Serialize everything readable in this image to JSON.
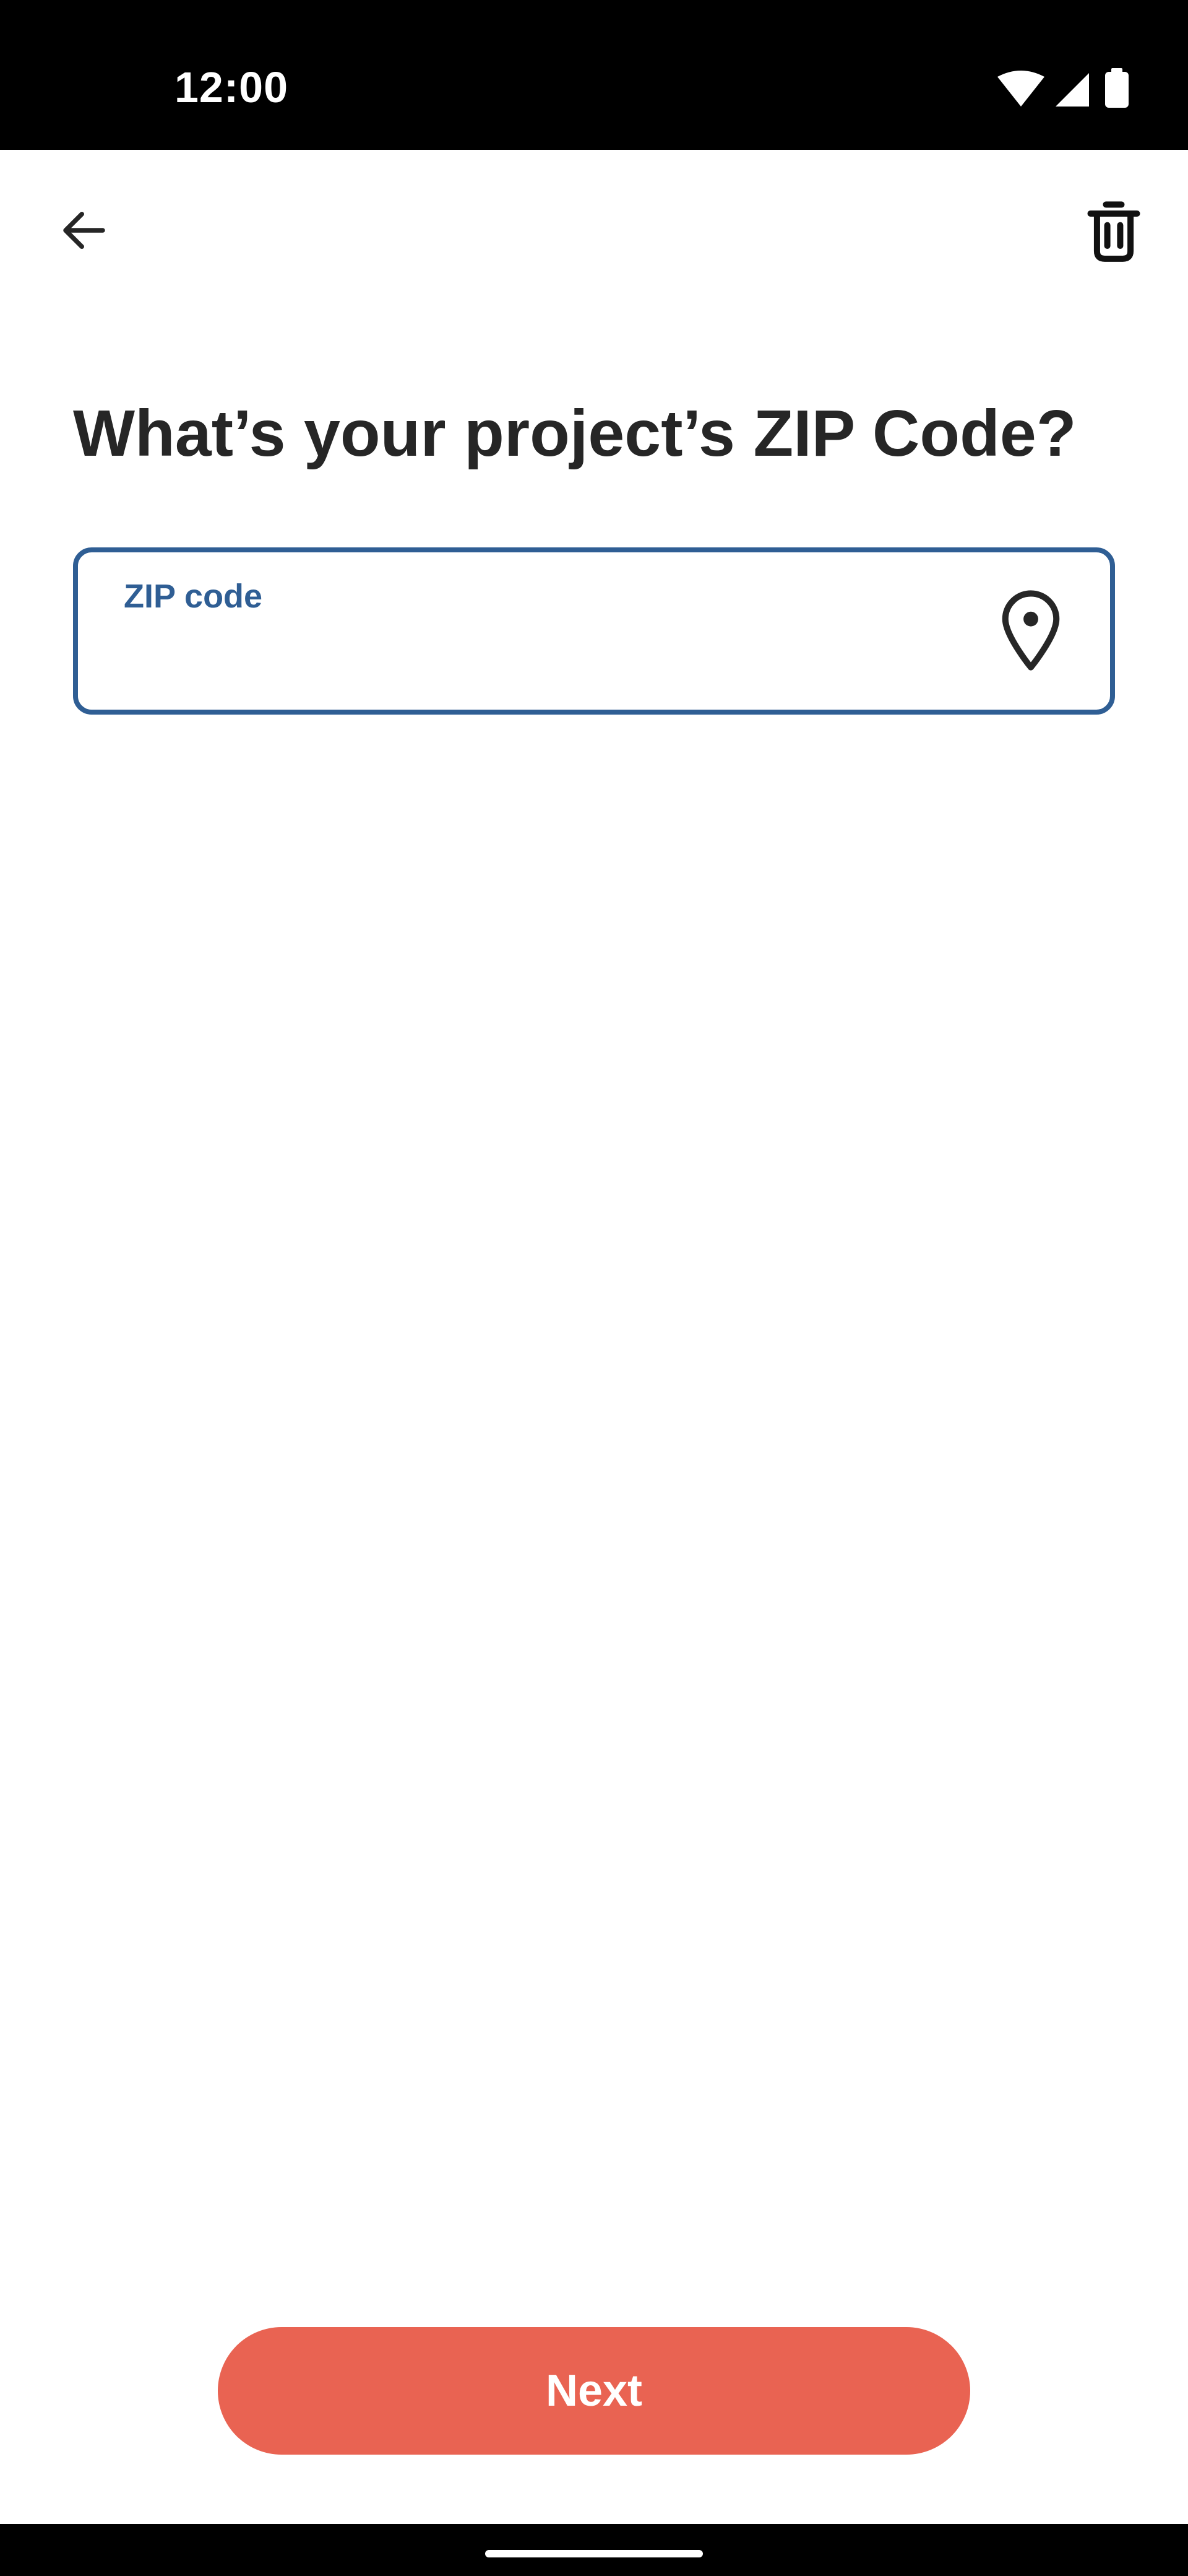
{
  "status_bar": {
    "time": "12:00",
    "icons": [
      "wifi-icon",
      "signal-icon",
      "battery-icon"
    ]
  },
  "top_bar": {
    "back_icon": "arrow-left-icon",
    "delete_icon": "trash-icon"
  },
  "main": {
    "title": "What’s your project’s ZIP Code?",
    "zip_field": {
      "label": "ZIP code",
      "value": "",
      "placeholder": "",
      "icon": "location-pin-icon"
    }
  },
  "footer": {
    "next_label": "Next"
  },
  "colors": {
    "accent": "#2f5e94",
    "primary_button": "#e96352",
    "title_text": "#262626",
    "status_bar": "#000000"
  }
}
